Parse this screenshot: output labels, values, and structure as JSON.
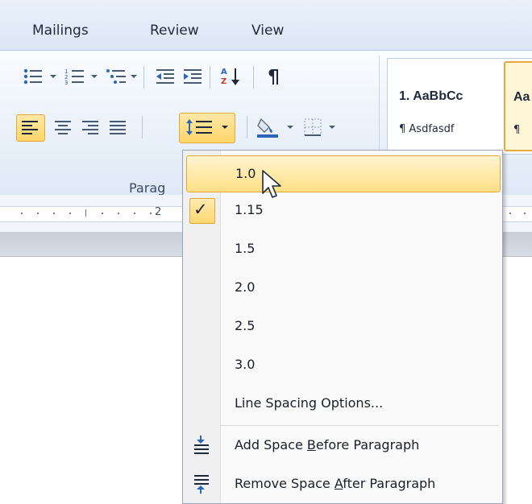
{
  "tabs": [
    {
      "label": "Mailings"
    },
    {
      "label": "Review"
    },
    {
      "label": "View"
    }
  ],
  "ribbon": {
    "group_label": "Parag",
    "ruler_number": "2",
    "styles": [
      {
        "preview": "1. AaBbCc",
        "name": "¶ Asdfasdf"
      },
      {
        "preview": "Aa",
        "name": "¶"
      }
    ]
  },
  "line_spacing_menu": {
    "selected_value": "1.15",
    "items": [
      {
        "label": "1.0",
        "hovered": true
      },
      {
        "label": "1.15",
        "checked": true
      },
      {
        "label": "1.5"
      },
      {
        "label": "2.0"
      },
      {
        "label": "2.5"
      },
      {
        "label": "3.0"
      },
      {
        "label": "Line Spacing Options..."
      }
    ],
    "add_space_before": {
      "prefix": "Add Space ",
      "accel": "B",
      "suffix": "efore Paragraph"
    },
    "remove_space_after": {
      "prefix": "Remove Space ",
      "accel": "A",
      "suffix": "fter Paragraph"
    }
  },
  "colors": {
    "highlight": "#ffd56a",
    "highlight_border": "#e4a93a",
    "ribbon_bg": "#dfe9f6"
  }
}
